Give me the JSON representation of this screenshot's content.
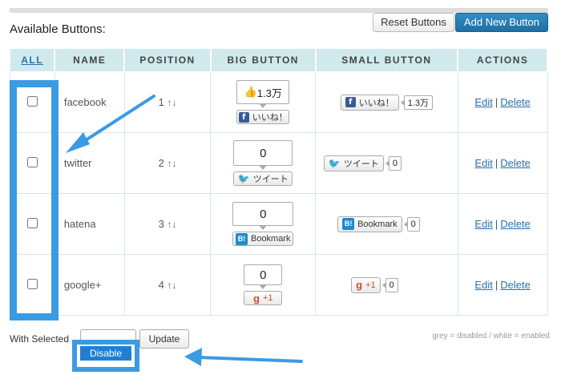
{
  "header": {
    "title": "Available Buttons:",
    "reset_label": "Reset Buttons",
    "add_label": "Add New Button"
  },
  "table": {
    "columns": [
      "ALL",
      "NAME",
      "POSITION",
      "BIG BUTTON",
      "SMALL BUTTON",
      "ACTIONS"
    ],
    "rows": [
      {
        "name": "facebook",
        "position": "1",
        "big_count": "1.3万",
        "big_label": "いいね！",
        "small_label": "いいね！",
        "small_count": "1.3万",
        "edit": "Edit",
        "delete": "Delete"
      },
      {
        "name": "twitter",
        "position": "2",
        "big_count": "0",
        "big_label": "ツイート",
        "small_label": "ツイート",
        "small_count": "0",
        "edit": "Edit",
        "delete": "Delete"
      },
      {
        "name": "hatena",
        "position": "3",
        "big_count": "0",
        "big_label": "Bookmark",
        "small_label": "Bookmark",
        "small_count": "0",
        "edit": "Edit",
        "delete": "Delete"
      },
      {
        "name": "google+",
        "position": "4",
        "big_count": "0",
        "big_label": "+1",
        "small_label": "+1",
        "small_count": "0",
        "edit": "Edit",
        "delete": "Delete"
      }
    ],
    "arrows": "↑↓",
    "separator": "|"
  },
  "footer": {
    "with_selected": "With Selected",
    "update_label": "Update",
    "dropdown_option": "Disable",
    "legend": "grey = disabled / white = enabled"
  },
  "icons": {
    "facebook": "f",
    "facebook_thumb": "👍",
    "twitter": "🐦",
    "hatena": "B!",
    "google": "g"
  },
  "colors": {
    "accent": "#3a9be3",
    "header_bg": "#cfe9ec",
    "link": "#2a6fae",
    "primary_button": "#2f8fc6"
  }
}
